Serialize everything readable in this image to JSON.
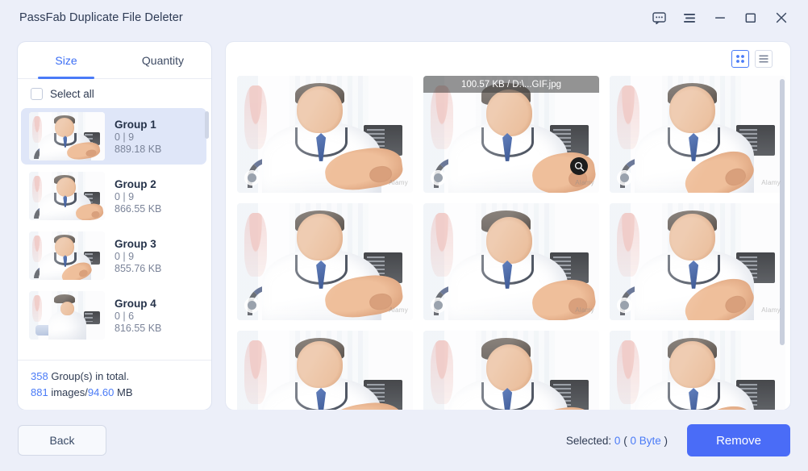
{
  "window": {
    "title": "PassFab Duplicate File Deleter",
    "controls": {
      "feedback": "feedback-icon",
      "menu": "menu-icon",
      "minimize": "minimize-icon",
      "maximize": "maximize-icon",
      "close": "close-icon"
    }
  },
  "sidebar": {
    "tabs": [
      {
        "label": "Size",
        "active": true
      },
      {
        "label": "Quantity",
        "active": false
      }
    ],
    "select_all_label": "Select all",
    "select_all_checked": false,
    "groups": [
      {
        "name": "Group 1",
        "count": "0 | 9",
        "size": "889.18 KB",
        "selected": true
      },
      {
        "name": "Group 2",
        "count": "0 | 9",
        "size": "866.55 KB",
        "selected": false
      },
      {
        "name": "Group 3",
        "count": "0 | 9",
        "size": "855.76 KB",
        "selected": false
      },
      {
        "name": "Group 4",
        "count": "0 | 6",
        "size": "816.55 KB",
        "selected": false
      }
    ],
    "footer": {
      "total_groups": "358",
      "total_groups_suffix": "Group(s) in total.",
      "images_count": "881",
      "images_label": "images/",
      "total_size": "94.60",
      "size_unit": "MB"
    }
  },
  "content": {
    "view_modes": [
      {
        "name": "grid-view",
        "active": true
      },
      {
        "name": "list-view",
        "active": false
      }
    ],
    "hover_tooltip": "100.57 KB / D:\\...GIF.jpg",
    "watermark": "Alamy",
    "thumbnails": [
      {
        "id": 1,
        "variant": "v1",
        "hovered": false
      },
      {
        "id": 2,
        "variant": "v2",
        "hovered": true
      },
      {
        "id": 3,
        "variant": "v3",
        "hovered": false
      },
      {
        "id": 4,
        "variant": "v1",
        "hovered": false
      },
      {
        "id": 5,
        "variant": "v2",
        "hovered": false
      },
      {
        "id": 6,
        "variant": "v3",
        "hovered": false
      },
      {
        "id": 7,
        "variant": "v1",
        "hovered": false
      },
      {
        "id": 8,
        "variant": "v2",
        "hovered": false
      },
      {
        "id": 9,
        "variant": "v3",
        "hovered": false
      }
    ]
  },
  "footer": {
    "back_label": "Back",
    "selected_prefix": "Selected:",
    "selected_count": "0",
    "selected_open": "(",
    "selected_size": "0 Byte",
    "selected_close": ")",
    "remove_label": "Remove"
  },
  "colors": {
    "accent": "#4a7bf7",
    "primary_button": "#4a6cf7",
    "app_bg": "#eceff9",
    "panel_bg": "#ffffff",
    "selected_row": "#dfe6f8"
  }
}
